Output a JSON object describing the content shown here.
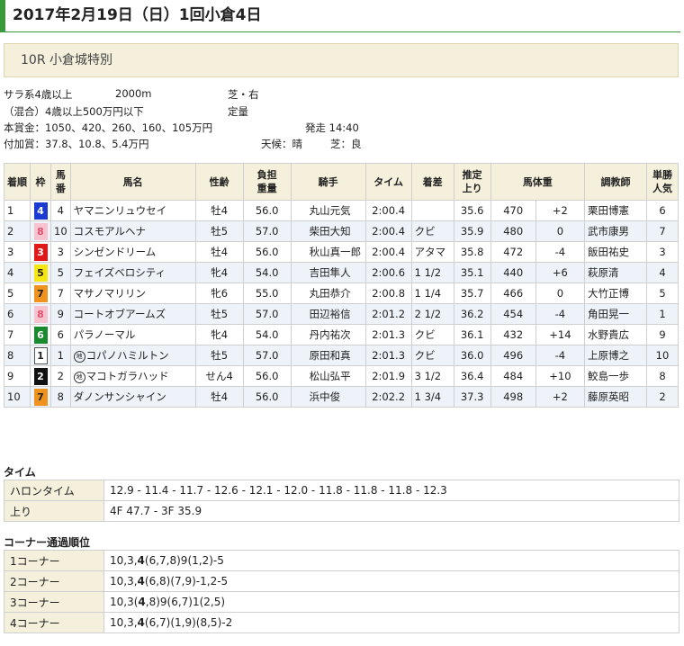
{
  "race_date": "2017年2月19日（日）1回小倉4日",
  "race_name": "10R 小倉城特別",
  "conditions": {
    "class": "サラ系4歳以上",
    "distance": "2000m",
    "surface": "芝・右",
    "mixed": "（混合）4歳以上500万円以下",
    "weight_rule": "定量",
    "prize": "本賞金：1050、420、260、160、105万円",
    "start": "発走 14:40",
    "extra_prize": "付加賞：37.8、10.8、5.4万円",
    "weather": "天候：晴",
    "track": "芝：良"
  },
  "columns": [
    "着順",
    "枠",
    "馬番",
    "馬名",
    "性齢",
    "負担重量",
    "騎手",
    "タイム",
    "着差",
    "推定上り",
    "馬体重",
    "調教師",
    "単勝人気"
  ],
  "colors": {
    "accent_green": "#3a9a3a",
    "header_bg": "#f4f0dc",
    "row_alt": "#eef2f9"
  },
  "rows": [
    {
      "rank": "1",
      "frame": "4",
      "frame_bg": "#1a3ad0",
      "frame_fg": "#ffffff",
      "num": "4",
      "local": "",
      "horse": "ヤマニンリュウセイ",
      "sexage": "牡4",
      "weight": "56.0",
      "jockey": "丸山元気",
      "time": "2:00.4",
      "margin": "",
      "last3f": "35.6",
      "bw": "470",
      "bwd": "+2",
      "trainer": "栗田博憲",
      "pop": "6"
    },
    {
      "rank": "2",
      "frame": "8",
      "frame_bg": "#f7c3cf",
      "frame_fg": "#e05070",
      "num": "10",
      "local": "",
      "horse": "コスモアルヘナ",
      "sexage": "牡5",
      "weight": "57.0",
      "jockey": "柴田大知",
      "time": "2:00.4",
      "margin": "クビ",
      "last3f": "35.9",
      "bw": "480",
      "bwd": "0",
      "trainer": "武市康男",
      "pop": "7"
    },
    {
      "rank": "3",
      "frame": "3",
      "frame_bg": "#e01818",
      "frame_fg": "#ffffff",
      "num": "3",
      "local": "",
      "horse": "シンゼンドリーム",
      "sexage": "牡4",
      "weight": "56.0",
      "jockey": "秋山真一郎",
      "time": "2:00.4",
      "margin": "アタマ",
      "last3f": "35.8",
      "bw": "472",
      "bwd": "-4",
      "trainer": "飯田祐史",
      "pop": "3"
    },
    {
      "rank": "4",
      "frame": "5",
      "frame_bg": "#f5e614",
      "frame_fg": "#222222",
      "num": "5",
      "local": "",
      "horse": "フェイズベロシティ",
      "sexage": "牝4",
      "weight": "54.0",
      "jockey": "吉田隼人",
      "time": "2:00.6",
      "margin": "1 1/2",
      "last3f": "35.1",
      "bw": "440",
      "bwd": "+6",
      "trainer": "萩原清",
      "pop": "4"
    },
    {
      "rank": "5",
      "frame": "7",
      "frame_bg": "#f0921e",
      "frame_fg": "#222222",
      "num": "7",
      "local": "",
      "horse": "マサノマリリン",
      "sexage": "牝6",
      "weight": "55.0",
      "jockey": "丸田恭介",
      "time": "2:00.8",
      "margin": "1 1/4",
      "last3f": "35.7",
      "bw": "466",
      "bwd": "0",
      "trainer": "大竹正博",
      "pop": "5"
    },
    {
      "rank": "6",
      "frame": "8",
      "frame_bg": "#f7c3cf",
      "frame_fg": "#e05070",
      "num": "9",
      "local": "",
      "horse": "コートオブアームズ",
      "sexage": "牡5",
      "weight": "57.0",
      "jockey": "田辺裕信",
      "time": "2:01.2",
      "margin": "2 1/2",
      "last3f": "36.2",
      "bw": "454",
      "bwd": "-4",
      "trainer": "角田晃一",
      "pop": "1"
    },
    {
      "rank": "7",
      "frame": "6",
      "frame_bg": "#1a8a2e",
      "frame_fg": "#ffffff",
      "num": "6",
      "local": "",
      "horse": "パラノーマル",
      "sexage": "牝4",
      "weight": "54.0",
      "jockey": "丹内祐次",
      "time": "2:01.3",
      "margin": "クビ",
      "last3f": "36.1",
      "bw": "432",
      "bwd": "+14",
      "trainer": "水野貴広",
      "pop": "9"
    },
    {
      "rank": "8",
      "frame": "1",
      "frame_bg": "#ffffff",
      "frame_fg": "#222222",
      "num": "1",
      "local": "地",
      "horse": "コパノハミルトン",
      "sexage": "牡5",
      "weight": "57.0",
      "jockey": "原田和真",
      "time": "2:01.3",
      "margin": "クビ",
      "last3f": "36.0",
      "bw": "496",
      "bwd": "-4",
      "trainer": "上原博之",
      "pop": "10"
    },
    {
      "rank": "9",
      "frame": "2",
      "frame_bg": "#111111",
      "frame_fg": "#ffffff",
      "num": "2",
      "local": "地",
      "horse": "マコトガラハッド",
      "sexage": "せん4",
      "weight": "56.0",
      "jockey": "松山弘平",
      "time": "2:01.9",
      "margin": "3 1/2",
      "last3f": "36.4",
      "bw": "484",
      "bwd": "+10",
      "trainer": "鮫島一歩",
      "pop": "8"
    },
    {
      "rank": "10",
      "frame": "7",
      "frame_bg": "#f0921e",
      "frame_fg": "#222222",
      "num": "8",
      "local": "",
      "horse": "ダノンサンシャイン",
      "sexage": "牡4",
      "weight": "56.0",
      "jockey": "浜中俊",
      "time": "2:02.2",
      "margin": "1 3/4",
      "last3f": "37.3",
      "bw": "498",
      "bwd": "+2",
      "trainer": "藤原英昭",
      "pop": "2"
    }
  ],
  "time_section": {
    "title": "タイム",
    "rows": [
      {
        "label": "ハロンタイム",
        "value": "12.9 - 11.4 - 11.7 - 12.6 - 12.1 - 12.0 - 11.8 - 11.8 - 11.8 - 12.3"
      },
      {
        "label": "上り",
        "value": "4F 47.7 - 3F 35.9"
      }
    ]
  },
  "corner_section": {
    "title": "コーナー通過順位",
    "rows": [
      {
        "label": "1コーナー",
        "pre": "10,3,",
        "bold": "4",
        "post": "(6,7,8)9(1,2)-5"
      },
      {
        "label": "2コーナー",
        "pre": "10,3,",
        "bold": "4",
        "post": "(6,8)(7,9)-1,2-5"
      },
      {
        "label": "3コーナー",
        "pre": "10,3(",
        "bold": "4",
        "post": ",8)9(6,7)1(2,5)"
      },
      {
        "label": "4コーナー",
        "pre": "10,3,",
        "bold": "4",
        "post": "(6,7)(1,9)(8,5)-2"
      }
    ]
  }
}
